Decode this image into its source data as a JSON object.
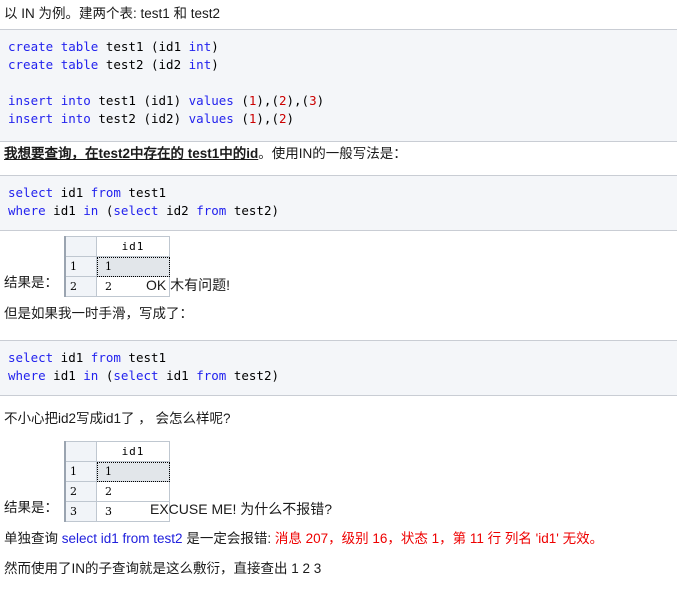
{
  "paragraphs": {
    "intro": "以 IN 为例。建两个表: test1 和 test2",
    "goal_bold": "我想要查询，在test2中存在的  test1中的id",
    "goal_rest": "。使用IN的一般写法是：",
    "slip": "但是如果我一时手滑，写成了：",
    "oops": "不小心把id2写成id1了 ， 会怎么样呢?",
    "error_prefix": "单独查询 ",
    "error_sql": "select id1 from test2",
    "error_middle": " 是一定会报错: ",
    "error_message": "消息 207，级别 16，状态 1，第 11 行 列名 'id1' 无效。",
    "final": "然而使用了IN的子查询就是这么敷衍，直接查出 1 2 3"
  },
  "code_blocks": {
    "create": {
      "lines": [
        [
          {
            "t": "create",
            "c": "kw"
          },
          {
            "t": " ",
            "c": "pl"
          },
          {
            "t": "table",
            "c": "kw"
          },
          {
            "t": " test1 (id1 ",
            "c": "pl"
          },
          {
            "t": "int",
            "c": "kw"
          },
          {
            "t": ")",
            "c": "pl"
          }
        ],
        [
          {
            "t": "create",
            "c": "kw"
          },
          {
            "t": " ",
            "c": "pl"
          },
          {
            "t": "table",
            "c": "kw"
          },
          {
            "t": " test2 (id2 ",
            "c": "pl"
          },
          {
            "t": "int",
            "c": "kw"
          },
          {
            "t": ")",
            "c": "pl"
          }
        ],
        [],
        [
          {
            "t": "insert",
            "c": "kw"
          },
          {
            "t": " ",
            "c": "pl"
          },
          {
            "t": "into",
            "c": "kw"
          },
          {
            "t": " test1 (id1) ",
            "c": "pl"
          },
          {
            "t": "values",
            "c": "kw"
          },
          {
            "t": " (",
            "c": "pl"
          },
          {
            "t": "1",
            "c": "num"
          },
          {
            "t": "),(",
            "c": "pl"
          },
          {
            "t": "2",
            "c": "num"
          },
          {
            "t": "),(",
            "c": "pl"
          },
          {
            "t": "3",
            "c": "num"
          },
          {
            "t": ")",
            "c": "pl"
          }
        ],
        [
          {
            "t": "insert",
            "c": "kw"
          },
          {
            "t": " ",
            "c": "pl"
          },
          {
            "t": "into",
            "c": "kw"
          },
          {
            "t": " test2 (id2) ",
            "c": "pl"
          },
          {
            "t": "values",
            "c": "kw"
          },
          {
            "t": " (",
            "c": "pl"
          },
          {
            "t": "1",
            "c": "num"
          },
          {
            "t": "),(",
            "c": "pl"
          },
          {
            "t": "2",
            "c": "num"
          },
          {
            "t": ")",
            "c": "pl"
          }
        ]
      ]
    },
    "select_in_ok": {
      "lines": [
        [
          {
            "t": "select",
            "c": "kw"
          },
          {
            "t": " id1 ",
            "c": "pl"
          },
          {
            "t": "from",
            "c": "kw"
          },
          {
            "t": " test1",
            "c": "pl"
          }
        ],
        [
          {
            "t": "where",
            "c": "kw"
          },
          {
            "t": " id1 ",
            "c": "pl"
          },
          {
            "t": "in",
            "c": "kw"
          },
          {
            "t": " (",
            "c": "pl"
          },
          {
            "t": "select",
            "c": "kw"
          },
          {
            "t": " id2 ",
            "c": "pl"
          },
          {
            "t": "from",
            "c": "kw"
          },
          {
            "t": " test2)",
            "c": "pl"
          }
        ]
      ]
    },
    "select_in_bad": {
      "lines": [
        [
          {
            "t": "select",
            "c": "kw"
          },
          {
            "t": " id1 ",
            "c": "pl"
          },
          {
            "t": "from",
            "c": "kw"
          },
          {
            "t": " test1",
            "c": "pl"
          }
        ],
        [
          {
            "t": "where",
            "c": "kw"
          },
          {
            "t": " id1 ",
            "c": "pl"
          },
          {
            "t": "in",
            "c": "kw"
          },
          {
            "t": " (",
            "c": "pl"
          },
          {
            "t": "select",
            "c": "kw"
          },
          {
            "t": " id1 ",
            "c": "pl"
          },
          {
            "t": "from",
            "c": "kw"
          },
          {
            "t": " test2)",
            "c": "pl"
          }
        ]
      ]
    }
  },
  "results": {
    "first": {
      "label": "结果是：",
      "note": "OK 木有问题!",
      "columns": [
        "id1"
      ],
      "rows": [
        {
          "n": "1",
          "values": [
            "1"
          ],
          "selected": true
        },
        {
          "n": "2",
          "values": [
            "2"
          ],
          "selected": false
        }
      ]
    },
    "second": {
      "label": "结果是：",
      "note": "EXCUSE ME!  为什么不报错?",
      "columns": [
        "id1"
      ],
      "rows": [
        {
          "n": "1",
          "values": [
            "1"
          ],
          "selected": true
        },
        {
          "n": "2",
          "values": [
            "2"
          ],
          "selected": false
        },
        {
          "n": "3",
          "values": [
            "3"
          ],
          "selected": false
        }
      ]
    }
  },
  "colors": {
    "keyword": "#2222ee",
    "number": "#cc0000",
    "error": "#ee0000",
    "code_bg": "#f4f6f9",
    "code_border": "#c9cdd4",
    "grid_border": "#bfc7d0",
    "selected_cell": "#e2e6ea"
  }
}
